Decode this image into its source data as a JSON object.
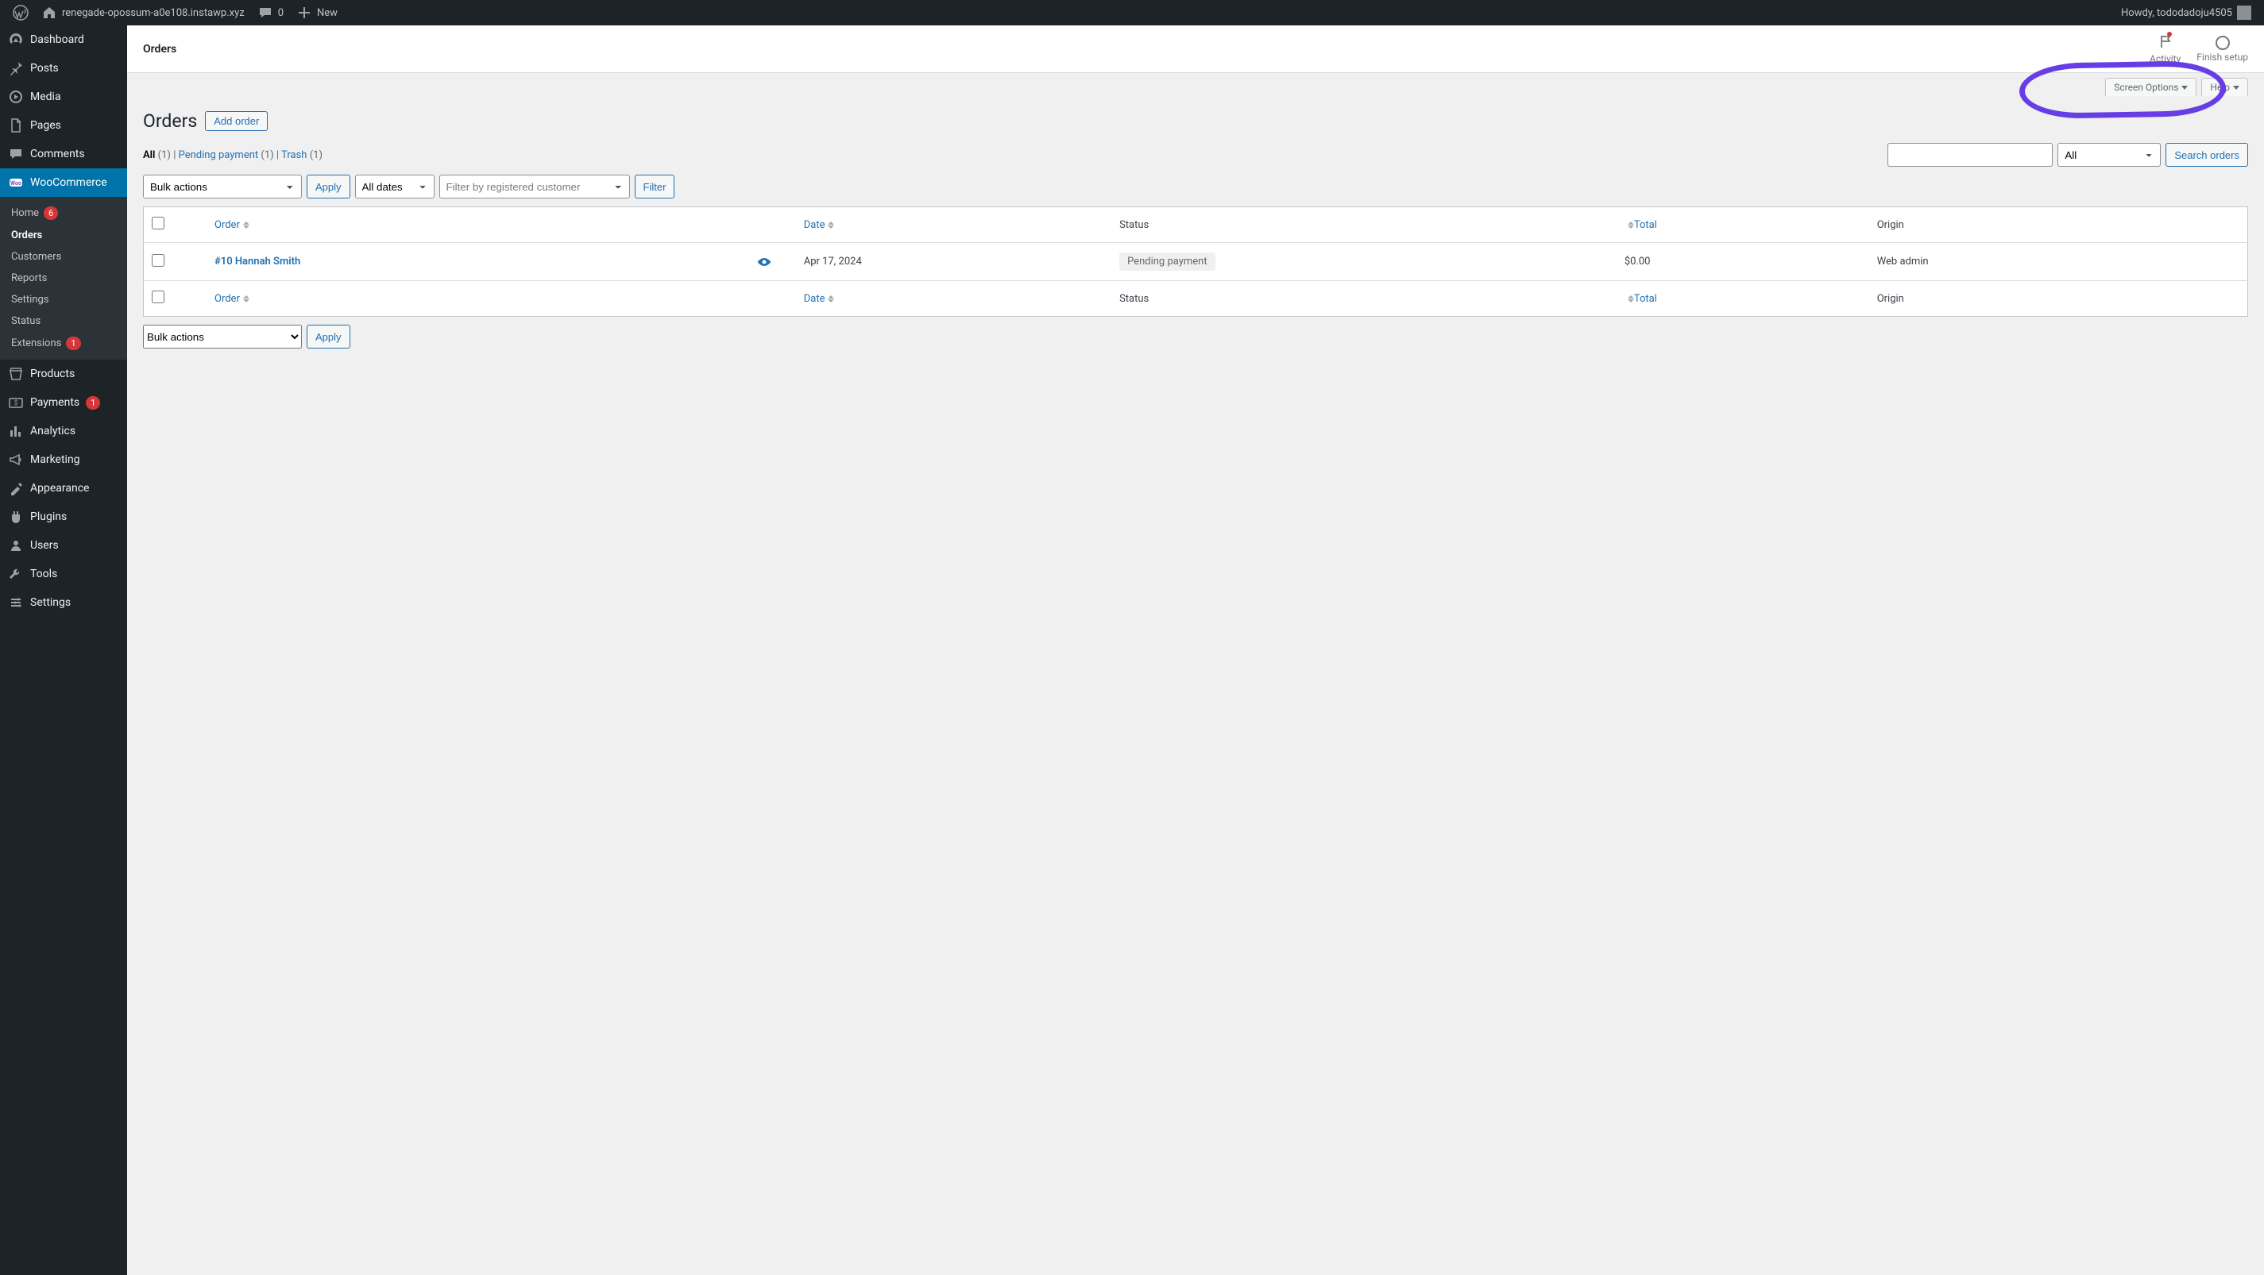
{
  "adminbar": {
    "site_name": "renegade-opossum-a0e108.instawp.xyz",
    "comments_count": "0",
    "new_label": "New",
    "howdy": "Howdy, tododadoju4505"
  },
  "menu": {
    "dashboard": "Dashboard",
    "posts": "Posts",
    "media": "Media",
    "pages": "Pages",
    "comments": "Comments",
    "woocommerce": "WooCommerce",
    "products": "Products",
    "payments": "Payments",
    "payments_badge": "1",
    "analytics": "Analytics",
    "marketing": "Marketing",
    "appearance": "Appearance",
    "plugins": "Plugins",
    "users": "Users",
    "tools": "Tools",
    "settings": "Settings"
  },
  "wc_submenu": {
    "home": "Home",
    "home_badge": "6",
    "orders": "Orders",
    "customers": "Customers",
    "reports": "Reports",
    "settings": "Settings",
    "status": "Status",
    "extensions": "Extensions",
    "extensions_badge": "1"
  },
  "wc_header": {
    "title": "Orders",
    "activity": "Activity",
    "finish": "Finish setup"
  },
  "tabs": {
    "screen_options": "Screen Options",
    "help": "Help"
  },
  "page": {
    "heading": "Orders",
    "add_order": "Add order"
  },
  "subsubsub": {
    "all_label": "All",
    "all_count": "(1)",
    "sep": " | ",
    "pending_label": "Pending payment",
    "pending_count": "(1)",
    "trash_label": "Trash",
    "trash_count": "(1)"
  },
  "search": {
    "select_all": "All",
    "btn": "Search orders"
  },
  "filters": {
    "bulk": "Bulk actions",
    "apply": "Apply",
    "dates": "All dates",
    "customer_placeholder": "Filter by registered customer",
    "filter": "Filter"
  },
  "columns": {
    "order": "Order",
    "date": "Date",
    "status": "Status",
    "total": "Total",
    "origin": "Origin"
  },
  "rows": [
    {
      "order_label": "#10 Hannah Smith",
      "date": "Apr 17, 2024",
      "status": "Pending payment",
      "total": "$0.00",
      "origin": "Web admin"
    }
  ]
}
